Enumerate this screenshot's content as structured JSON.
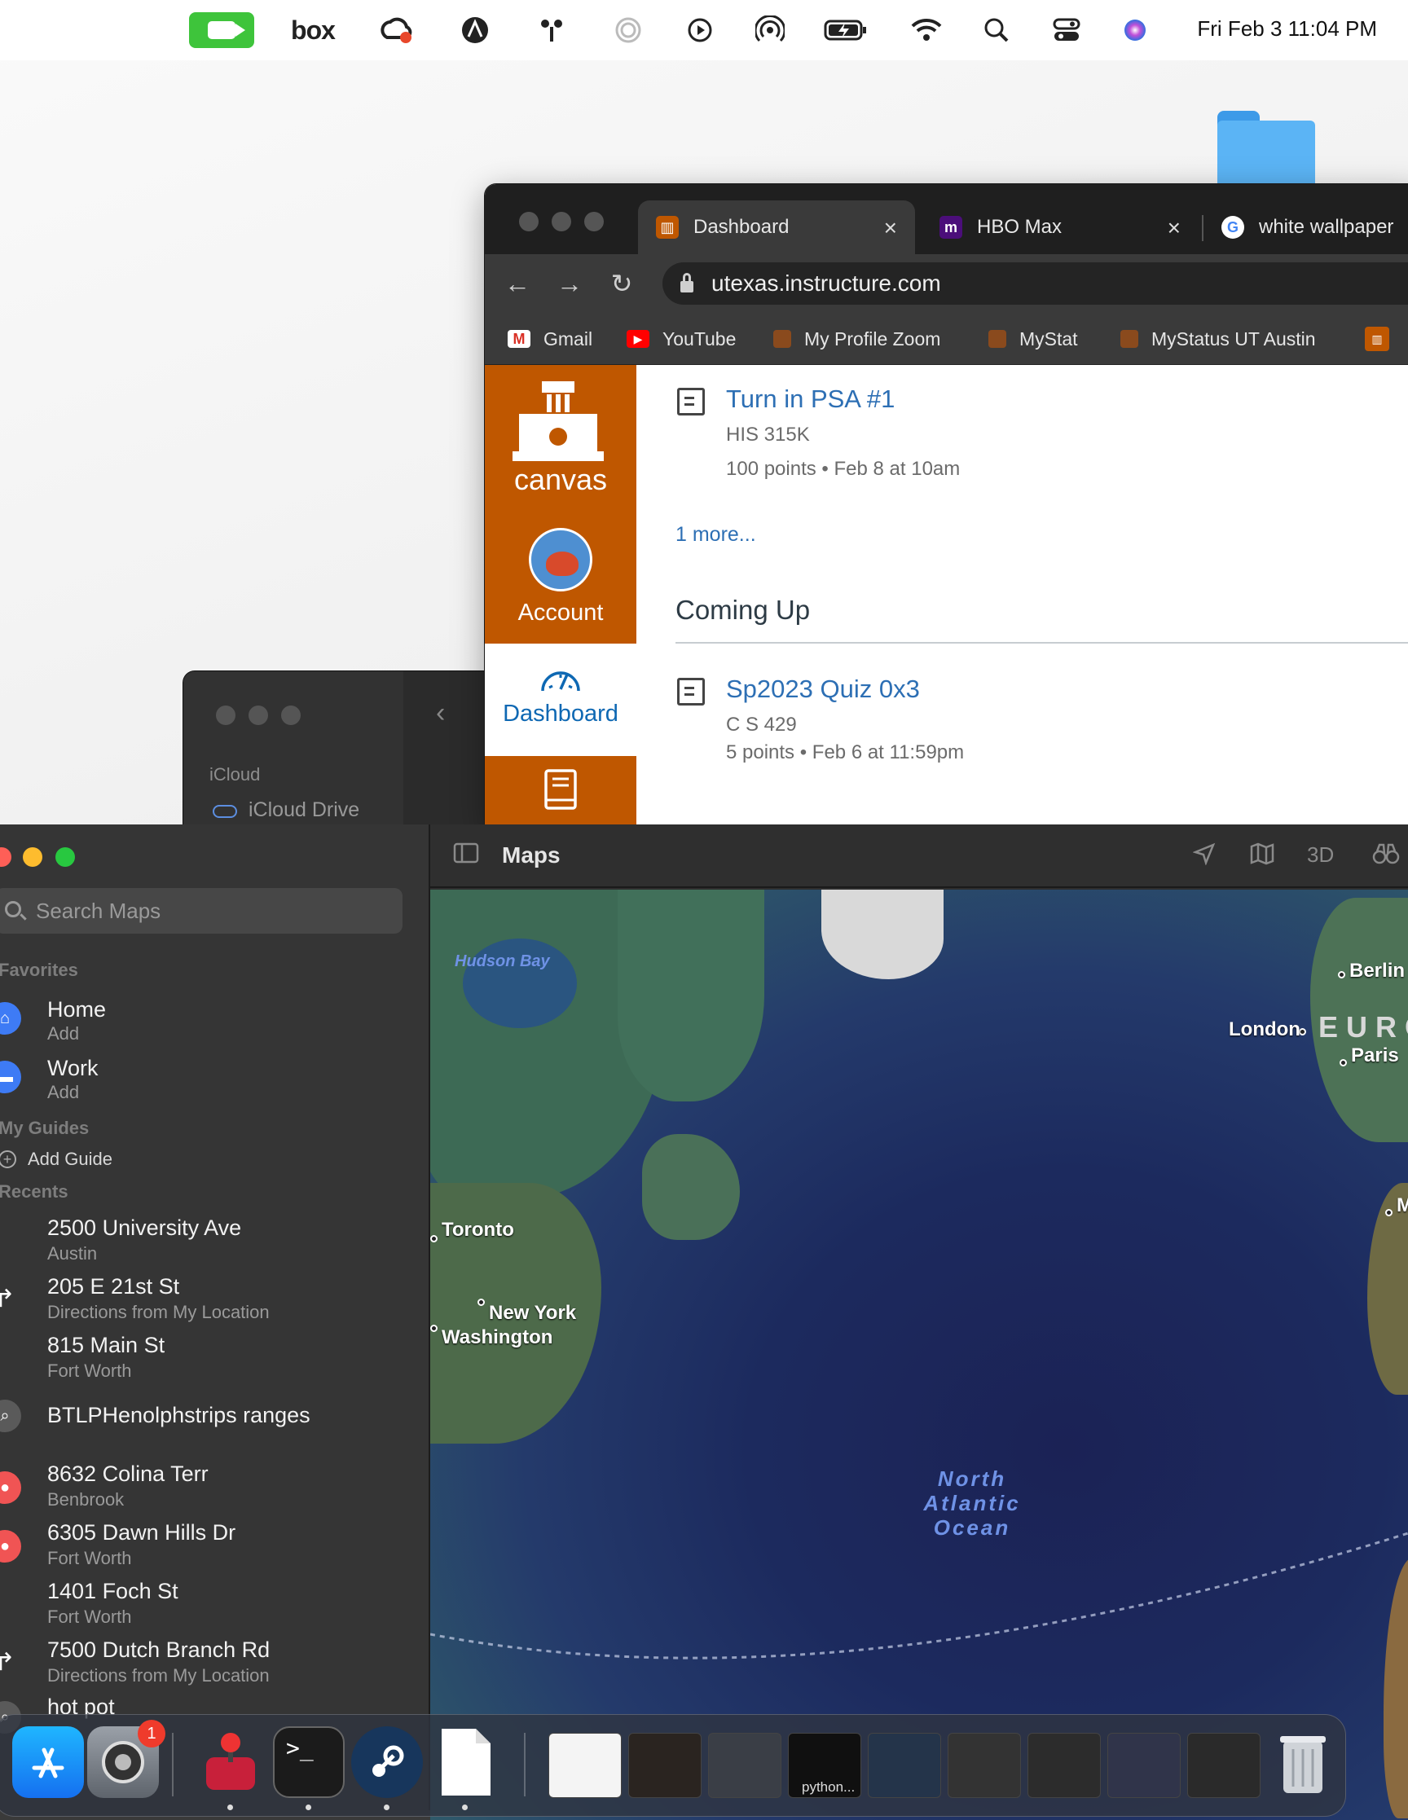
{
  "menubar": {
    "icons": [
      "facetime-video-icon",
      "box-icon",
      "creative-cloud-icon",
      "vpn-icon",
      "airplay-icon",
      "moon-icon",
      "play-icon",
      "airdrop-icon",
      "battery-icon",
      "wifi-icon",
      "spotlight-icon",
      "control-center-icon",
      "siri-icon"
    ],
    "box_label": "box",
    "clock": "Fri Feb 3  11:04 PM"
  },
  "browser": {
    "tabs": [
      {
        "label": "Dashboard",
        "active": true,
        "favicon_color": "#bf5700"
      },
      {
        "label": "HBO Max",
        "active": false,
        "favicon_color": "#4b0e7a"
      },
      {
        "label": "white wallpaper",
        "active": false,
        "favicon_color": "#ffffff"
      }
    ],
    "tab_close": "×",
    "url": "utexas.instructure.com",
    "bookmarks": [
      {
        "label": "Gmail",
        "icon": "gmail-icon",
        "color": "#d93025"
      },
      {
        "label": "YouTube",
        "icon": "youtube-icon",
        "color": "#ff0000"
      },
      {
        "label": "My Profile Zoom",
        "icon": "ut-shield-icon",
        "color": "#bf5700"
      },
      {
        "label": "MyStat",
        "icon": "ut-shield-icon",
        "color": "#bf5700"
      },
      {
        "label": "MyStatus UT Austin",
        "icon": "ut-shield-icon",
        "color": "#bf5700"
      }
    ]
  },
  "canvas": {
    "brand_color": "#bf5700",
    "logo_text": "canvas",
    "nav": {
      "account": "Account",
      "dashboard": "Dashboard"
    },
    "todo": {
      "item1": {
        "title": "Turn in PSA #1",
        "course": "HIS 315K",
        "meta": "100 points • Feb 8 at 10am"
      },
      "more_link": "1 more...",
      "coming_up_heading": "Coming Up",
      "item2": {
        "title": "Sp2023 Quiz 0x3",
        "course": "C S 429",
        "meta": "5 points • Feb 6 at 11:59pm"
      }
    }
  },
  "finder": {
    "section": "iCloud",
    "item": "iCloud Drive"
  },
  "maps": {
    "title": "Maps",
    "toolbar_3d": "3D",
    "search_placeholder": "Search Maps",
    "sections": {
      "favorites": "Favorites",
      "guides": "My Guides",
      "recents": "Recents"
    },
    "favorites": [
      {
        "title": "Home",
        "sub": "Add",
        "icon": "house-icon"
      },
      {
        "title": "Work",
        "sub": "Add",
        "icon": "briefcase-icon"
      }
    ],
    "add_guide": "Add Guide",
    "recents": [
      {
        "title": "2500 University Ave",
        "sub": "Austin",
        "icon": "none"
      },
      {
        "title": "205 E 21st St",
        "sub": "Directions from My Location",
        "icon": "directions-icon"
      },
      {
        "title": "815 Main St",
        "sub": "Fort Worth",
        "icon": "none"
      },
      {
        "title": "BTLPHenolphstrips ranges",
        "sub": "",
        "icon": "search-icon"
      },
      {
        "title": "8632 Colina Terr",
        "sub": "Benbrook",
        "icon": "pin-icon"
      },
      {
        "title": "6305 Dawn Hills Dr",
        "sub": "Fort Worth",
        "icon": "pin-icon"
      },
      {
        "title": "1401 Foch St",
        "sub": "Fort Worth",
        "icon": "none"
      },
      {
        "title": "7500 Dutch Branch Rd",
        "sub": "Directions from My Location",
        "icon": "directions-icon"
      },
      {
        "title": "hot pot",
        "sub": "",
        "icon": "search-icon"
      }
    ],
    "map_labels": {
      "hudson": "Hudson Bay",
      "atlantic": "North Atlantic Ocean",
      "europe": "EURO",
      "cities": [
        "Berlin",
        "London",
        "Paris",
        "Toronto",
        "New York",
        "Washington",
        "M"
      ]
    }
  },
  "dock": {
    "apps": [
      "app-store-icon",
      "system-settings-icon",
      "joystick-app-icon",
      "terminal-icon",
      "steam-icon",
      "document-icon"
    ],
    "settings_badge": "1",
    "window_caption": "python..."
  }
}
